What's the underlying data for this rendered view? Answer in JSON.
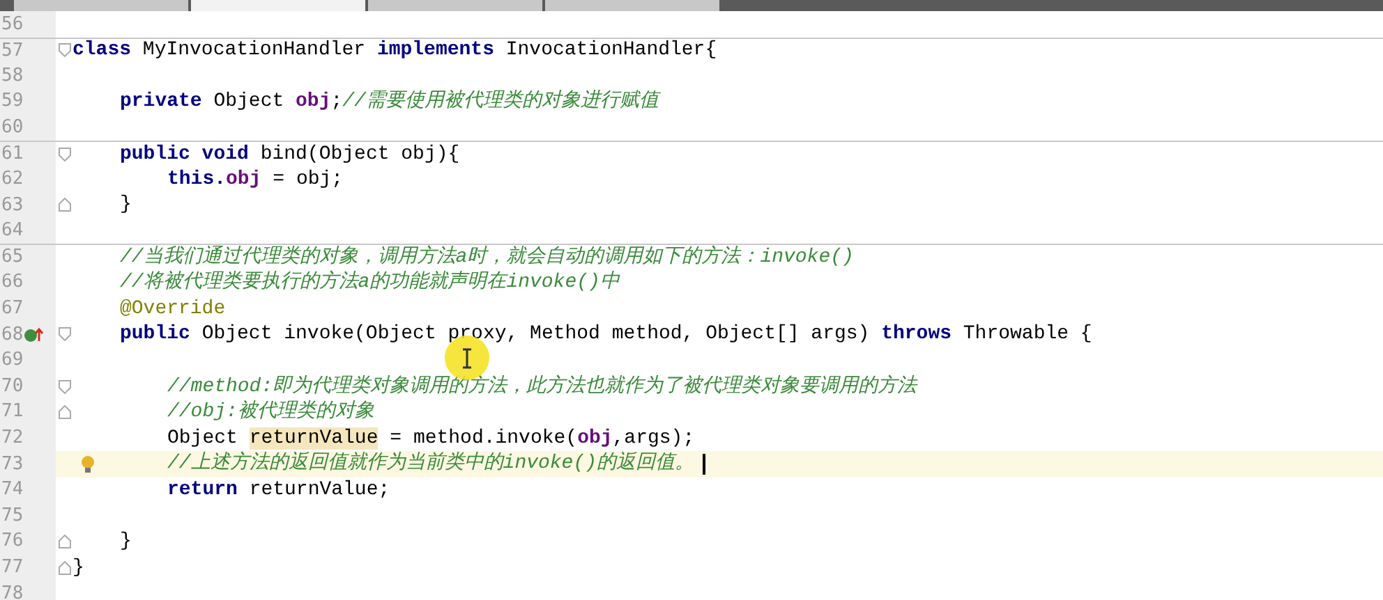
{
  "tabs": [
    {
      "selected": false
    },
    {
      "selected": true
    },
    {
      "selected": false
    },
    {
      "selected": false
    }
  ],
  "lines": [
    {
      "number": "56",
      "separator": false,
      "current": false
    },
    {
      "number": "57",
      "separator": true,
      "current": false,
      "fold": {
        "kind": "start"
      },
      "tokens": [
        {
          "kind": "keyword",
          "text": "class "
        },
        {
          "kind": "plain",
          "text": "MyInvocationHandler "
        },
        {
          "kind": "keyword",
          "text": "implements "
        },
        {
          "kind": "plain",
          "text": "InvocationHandler{"
        }
      ]
    },
    {
      "number": "58",
      "separator": false,
      "current": false
    },
    {
      "number": "59",
      "separator": false,
      "current": false,
      "indent": {
        "kind": "member"
      },
      "tokens": [
        {
          "kind": "keyword",
          "text": "private "
        },
        {
          "kind": "plain",
          "text": "Object "
        },
        {
          "kind": "field",
          "text": "obj"
        },
        {
          "kind": "plain",
          "text": ";"
        },
        {
          "kind": "comment",
          "text": "//需要使用被代理类的对象进行赋值"
        }
      ]
    },
    {
      "number": "60",
      "separator": false,
      "current": false
    },
    {
      "number": "61",
      "separator": true,
      "current": false,
      "fold": {
        "kind": "start"
      },
      "indent": {
        "kind": "member"
      },
      "tokens": [
        {
          "kind": "keyword",
          "text": "public void "
        },
        {
          "kind": "plain",
          "text": "bind(Object obj){"
        }
      ]
    },
    {
      "number": "62",
      "separator": false,
      "current": false,
      "indent": {
        "kind": "body"
      },
      "tokens": [
        {
          "kind": "keyword",
          "text": "this."
        },
        {
          "kind": "field",
          "text": "obj"
        },
        {
          "kind": "plain",
          "text": " = obj;"
        }
      ]
    },
    {
      "number": "63",
      "separator": false,
      "current": false,
      "fold": {
        "kind": "end"
      },
      "indent": {
        "kind": "member"
      },
      "tokens": [
        {
          "kind": "plain",
          "text": "}"
        }
      ]
    },
    {
      "number": "64",
      "separator": false,
      "current": false
    },
    {
      "number": "65",
      "separator": true,
      "current": false,
      "indent": {
        "kind": "member"
      },
      "tokens": [
        {
          "kind": "comment",
          "text": "//当我们通过代理类的对象，调用方法a时，就会自动的调用如下的方法：invoke()"
        }
      ]
    },
    {
      "number": "66",
      "separator": false,
      "current": false,
      "indent": {
        "kind": "member"
      },
      "tokens": [
        {
          "kind": "comment",
          "text": "//将被代理类要执行的方法a的功能就声明在invoke()中"
        }
      ]
    },
    {
      "number": "67",
      "separator": false,
      "current": false,
      "indent": {
        "kind": "member"
      },
      "tokens": [
        {
          "kind": "annotation",
          "text": "@Override"
        }
      ]
    },
    {
      "number": "68",
      "separator": false,
      "current": false,
      "fold": {
        "kind": "start"
      },
      "gutter_icon": {
        "kind": "override"
      },
      "indent": {
        "kind": "member"
      },
      "tokens": [
        {
          "kind": "keyword",
          "text": "public "
        },
        {
          "kind": "plain",
          "text": "Object invoke(Object proxy, Method method, Object[] args) "
        },
        {
          "kind": "keyword",
          "text": "throws "
        },
        {
          "kind": "plain",
          "text": "Throwable {"
        }
      ]
    },
    {
      "number": "69",
      "separator": false,
      "current": false
    },
    {
      "number": "70",
      "separator": false,
      "current": false,
      "fold": {
        "kind": "start"
      },
      "indent": {
        "kind": "body"
      },
      "tokens": [
        {
          "kind": "comment",
          "text": "//method:即为代理类对象调用的方法，此方法也就作为了被代理类对象要调用的方法"
        }
      ]
    },
    {
      "number": "71",
      "separator": false,
      "current": false,
      "fold": {
        "kind": "end"
      },
      "indent": {
        "kind": "body"
      },
      "tokens": [
        {
          "kind": "comment",
          "text": "//obj:被代理类的对象"
        }
      ]
    },
    {
      "number": "72",
      "separator": false,
      "current": false,
      "indent": {
        "kind": "body"
      },
      "tokens": [
        {
          "kind": "plain",
          "text": "Object "
        },
        {
          "kind": "highlight",
          "text": "returnValue"
        },
        {
          "kind": "plain",
          "text": " = method.invoke("
        },
        {
          "kind": "field",
          "text": "obj"
        },
        {
          "kind": "plain",
          "text": ",args);"
        }
      ]
    },
    {
      "number": "73",
      "separator": false,
      "current": true,
      "gutter_icon": {
        "kind": "bulb"
      },
      "indent": {
        "kind": "body"
      },
      "tokens": [
        {
          "kind": "comment",
          "text": "//上述方法的返回值就作为当前类中的invoke()的返回值。"
        }
      ]
    },
    {
      "number": "74",
      "separator": false,
      "current": false,
      "indent": {
        "kind": "body"
      },
      "tokens": [
        {
          "kind": "keyword",
          "text": "return "
        },
        {
          "kind": "plain",
          "text": "returnValue;"
        }
      ]
    },
    {
      "number": "75",
      "separator": false,
      "current": false
    },
    {
      "number": "76",
      "separator": false,
      "current": false,
      "fold": {
        "kind": "end"
      },
      "indent": {
        "kind": "member"
      },
      "tokens": [
        {
          "kind": "plain",
          "text": "}"
        }
      ]
    },
    {
      "number": "77",
      "separator": false,
      "current": false,
      "fold": {
        "kind": "end"
      },
      "tokens": [
        {
          "kind": "plain",
          "text": "}"
        }
      ]
    },
    {
      "number": "78",
      "separator": false,
      "current": false
    }
  ]
}
